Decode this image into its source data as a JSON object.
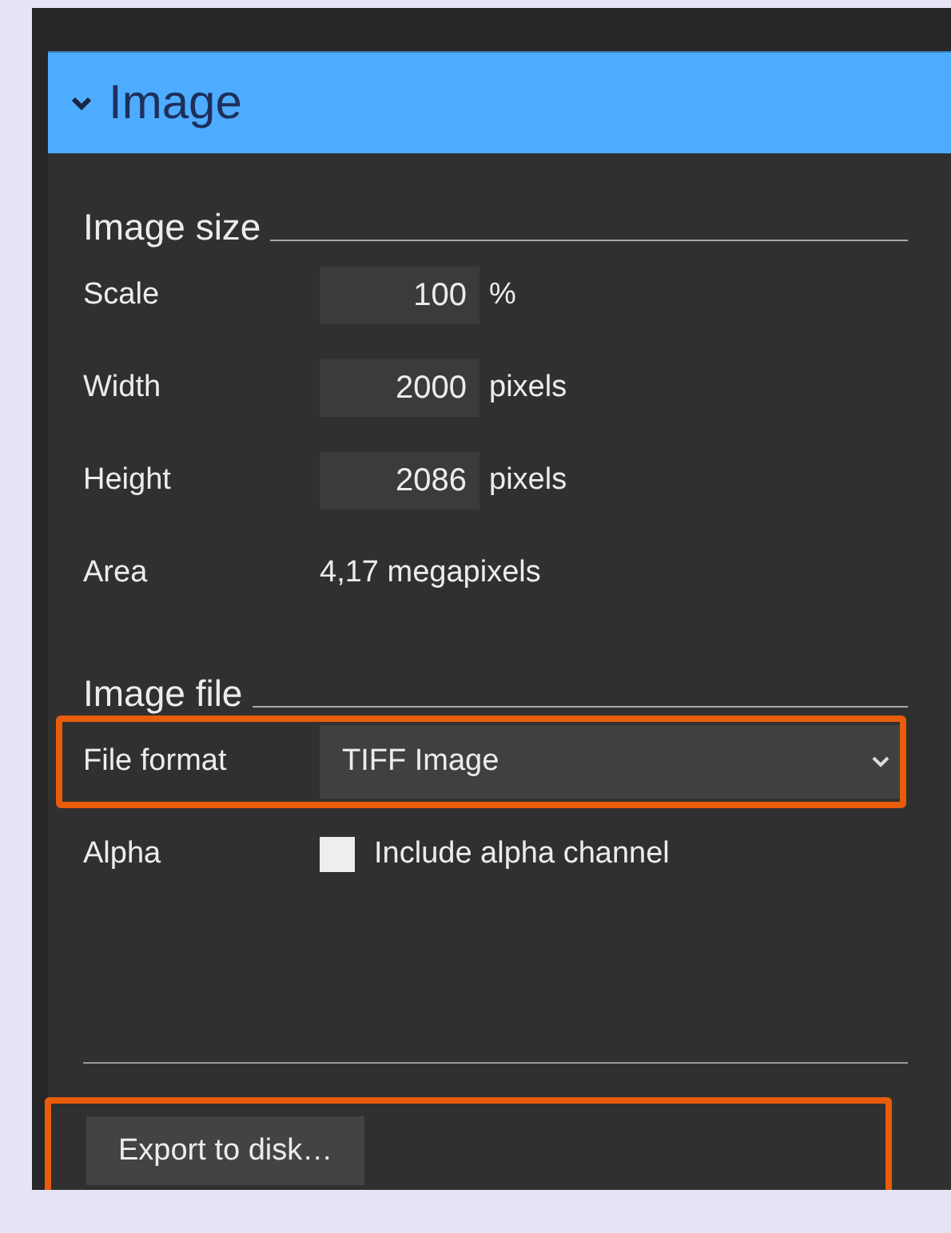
{
  "panel": {
    "title": "Image",
    "expanded": true
  },
  "sections": [
    {
      "title": "Image size",
      "rows": [
        {
          "kind": "number",
          "label": "Scale",
          "value": "100",
          "unit": "%"
        },
        {
          "kind": "number",
          "label": "Width",
          "value": "2000",
          "unit": "pixels"
        },
        {
          "kind": "number",
          "label": "Height",
          "value": "2086",
          "unit": "pixels"
        },
        {
          "kind": "text",
          "label": "Area",
          "value": "4,17 megapixels"
        }
      ]
    },
    {
      "title": "Image file",
      "rows": [
        {
          "kind": "select",
          "label": "File format",
          "value": "TIFF Image",
          "highlighted": true
        },
        {
          "kind": "checkbox",
          "label": "Alpha",
          "text": "Include alpha channel",
          "checked": false
        }
      ]
    }
  ],
  "export_button": {
    "label": "Export to disk…",
    "highlighted": true
  }
}
